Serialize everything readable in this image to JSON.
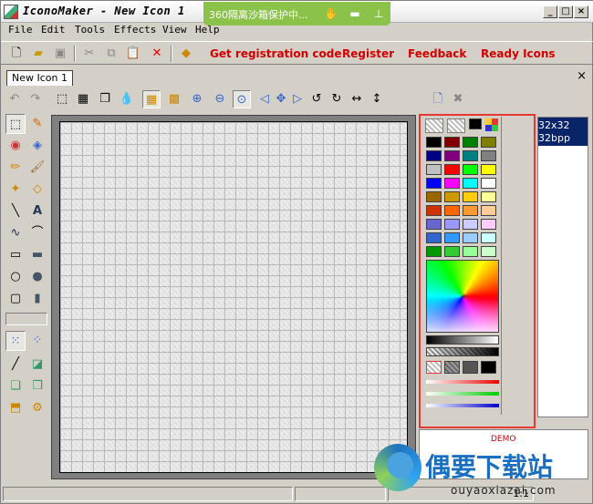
{
  "window": {
    "title": "IconoMaker - New Icon 1",
    "sandbox_text": "360隔离沙箱保护中...",
    "minimize_glyph": "_",
    "maximize_glyph": "□",
    "close_glyph": "×"
  },
  "menu": [
    "File",
    "Edit",
    "Tools",
    "Effects",
    "View",
    "Help"
  ],
  "toolbar": {
    "links": {
      "get_registration_code": "Get registration code",
      "register": "Register",
      "feedback": "Feedback",
      "ready_icons": "Ready Icons"
    },
    "icons": [
      "new-file-icon",
      "open-folder-icon",
      "save-icon",
      "cut-icon",
      "copy-icon",
      "paste-icon",
      "delete-icon",
      "book-icon"
    ]
  },
  "tabs": [
    {
      "label": "New Icon 1"
    }
  ],
  "tab_close_glyph": "×",
  "format_list": [
    {
      "size": "32x32",
      "depth": "32bpp"
    }
  ],
  "demo_label": "DEMO",
  "status": {
    "field3": "1:1"
  },
  "watermark": {
    "title": "偶要下载站",
    "subtitle": "ouyaoxiazai.com"
  },
  "colors": {
    "accent_red": "#d40000",
    "highlight_red": "#e53935",
    "selection_blue": "#0a246a",
    "sandbox_green": "#8bc34a"
  },
  "palette_swatches": [
    [
      "#000000",
      "#800000",
      "#008000",
      "#808000"
    ],
    [
      "#000080",
      "#800080",
      "#008080",
      "#808080"
    ],
    [
      "#c0c0c0",
      "#ff0000",
      "#00ff00",
      "#ffff00"
    ],
    [
      "#0000ff",
      "#ff00ff",
      "#00ffff",
      "#ffffff"
    ],
    [
      "#996600",
      "#cc9900",
      "#ffcc00",
      "#ffff99"
    ],
    [
      "#cc3300",
      "#ff6600",
      "#ff9933",
      "#ffcc99"
    ],
    [
      "#6666cc",
      "#9999ff",
      "#ccccff",
      "#ffccff"
    ],
    [
      "#3366cc",
      "#3399ff",
      "#99ccff",
      "#ccffff"
    ],
    [
      "#009900",
      "#33cc33",
      "#99ff99",
      "#ccffcc"
    ]
  ]
}
